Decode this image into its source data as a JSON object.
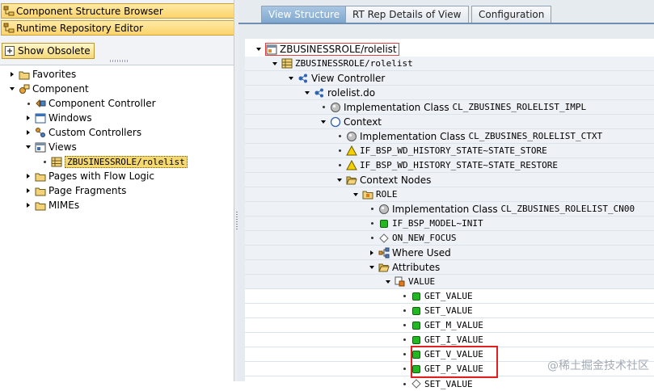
{
  "left": {
    "nav_buttons": [
      "Component Structure Browser",
      "Runtime Repository Editor"
    ],
    "show_obsolete": "Show Obsolete",
    "tree": [
      {
        "label": "Favorites"
      },
      {
        "label": "Component"
      },
      {
        "label": "Component Controller"
      },
      {
        "label": "Windows"
      },
      {
        "label": "Custom Controllers"
      },
      {
        "label": "Views"
      },
      {
        "label": "ZBUSINESSROLE/rolelist"
      },
      {
        "label": "Pages with Flow Logic"
      },
      {
        "label": "Page Fragments"
      },
      {
        "label": "MIMEs"
      }
    ]
  },
  "tabs": [
    "View Structure",
    "RT Rep Details of View",
    "Configuration"
  ],
  "right": {
    "tree": [
      {
        "label": "ZBUSINESSROLE/rolelist"
      },
      {
        "label": "ZBUSINESSROLE/rolelist"
      },
      {
        "label": "View Controller"
      },
      {
        "label": "rolelist.do"
      },
      {
        "label": "Implementation Class",
        "extra": "CL_ZBUSINES_ROLELIST_IMPL"
      },
      {
        "label": "Context"
      },
      {
        "label": "Implementation Class",
        "extra": "CL_ZBUSINES_ROLELIST_CTXT"
      },
      {
        "label": "IF_BSP_WD_HISTORY_STATE~STATE_STORE"
      },
      {
        "label": "IF_BSP_WD_HISTORY_STATE~STATE_RESTORE"
      },
      {
        "label": "Context Nodes"
      },
      {
        "label": "ROLE"
      },
      {
        "label": "Implementation Class",
        "extra": "CL_ZBUSINES_ROLELIST_CN00"
      },
      {
        "label": "IF_BSP_MODEL~INIT"
      },
      {
        "label": "ON_NEW_FOCUS"
      },
      {
        "label": "Where Used"
      },
      {
        "label": "Attributes"
      },
      {
        "label": "VALUE"
      },
      {
        "label": "GET_VALUE"
      },
      {
        "label": "SET_VALUE"
      },
      {
        "label": "GET_M_VALUE"
      },
      {
        "label": "GET_I_VALUE"
      },
      {
        "label": "GET_V_VALUE"
      },
      {
        "label": "GET_P_VALUE"
      },
      {
        "label": "SET_VALUE"
      }
    ]
  },
  "watermark": "@稀土掘金技术社区",
  "colors": {
    "accent": "#7fa8cf",
    "highlight": "#e02020",
    "method": "#22b822",
    "selection": "#f4d872"
  }
}
